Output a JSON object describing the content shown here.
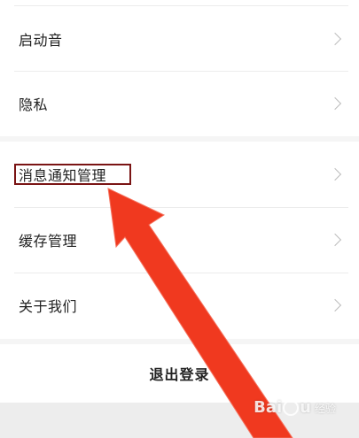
{
  "settings": {
    "group1": [
      {
        "label": "启动音"
      },
      {
        "label": "隐私"
      }
    ],
    "group2": [
      {
        "label": "消息通知管理"
      },
      {
        "label": "缓存管理"
      },
      {
        "label": "关于我们"
      }
    ],
    "logout_label": "退出登录"
  },
  "annotation": {
    "highlight_color": "#7a1414",
    "arrow_color": "#f0391f"
  },
  "watermark": {
    "brand": "Bai",
    "brand_tail": "u",
    "suffix": "经验"
  }
}
